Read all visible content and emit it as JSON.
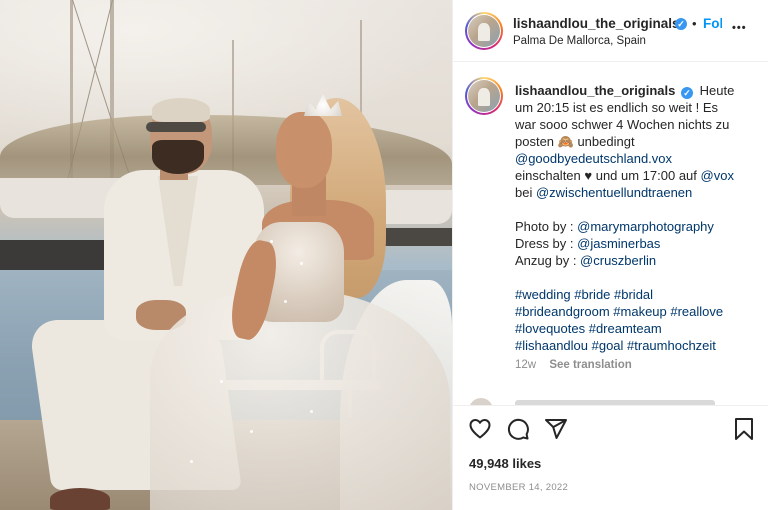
{
  "post": {
    "username": "lishaandlou_the_originals",
    "follow_label": "Follow",
    "separator": "•",
    "location": "Palma De Mallorca, Spain",
    "more_label": "•••",
    "caption": {
      "line1": "Heute",
      "line2": "um 20:15 ist es endlich so weit ! Es",
      "line3": "war sooo schwer 4 Wochen nichts zu",
      "line4a": "posten 🙈 unbedingt",
      "mention1": "@goodbyedeutschland.vox",
      "line6a": "einschalten ♥ und um 17:00 auf ",
      "mention2": "@vox",
      "line7a": "bei ",
      "mention3": "@zwischentuellundtraenen",
      "photo_label": "Photo by : ",
      "photo_mention": "@marymarphotography",
      "dress_label": "Dress by : ",
      "dress_mention": "@jasminerbas",
      "suit_label": "Anzug by : ",
      "suit_mention": "@cruszberlin",
      "hashtags_line1": "#wedding #bride #bridal",
      "hashtags_line2": "#brideandgroom #makeup #reallove",
      "hashtags_line3": "#lovequotes #dreamteam",
      "hashtags_line4": "#lishaandlou #goal #traumhochzeit"
    },
    "age": "12w",
    "see_translation": "See translation",
    "likes": "49,948 likes",
    "date": "NOVEMBER 14, 2022",
    "icons": {
      "like": "heart-icon",
      "comment": "comment-icon",
      "share": "send-icon",
      "save": "bookmark-icon",
      "verified": "verified-badge-icon",
      "more": "more-options-icon"
    },
    "colors": {
      "link": "#00376b",
      "follow": "#0095f6",
      "verified": "#3897f0",
      "muted": "#8e8e8e"
    }
  }
}
